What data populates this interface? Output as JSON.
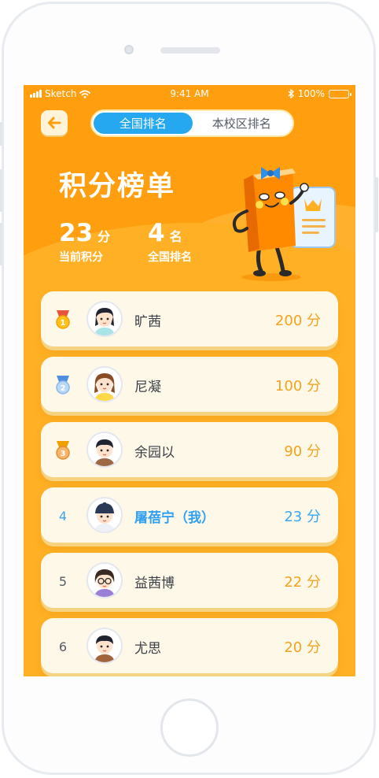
{
  "status_bar": {
    "carrier": "Sketch",
    "time": "9:41 AM",
    "battery": "100%"
  },
  "tabs": [
    {
      "label": "全国排名",
      "active": true
    },
    {
      "label": "本校区排名",
      "active": false
    }
  ],
  "page_title": "积分榜单",
  "stats": {
    "points": {
      "value": "23",
      "unit": "分",
      "label": "当前积分"
    },
    "rank": {
      "value": "4",
      "unit": "名",
      "label": "全国排名"
    }
  },
  "ranking": [
    {
      "rank": "1",
      "medal": "gold",
      "name": "旷茜",
      "score": "200 分",
      "me": false
    },
    {
      "rank": "2",
      "medal": "silver",
      "name": "尼凝",
      "score": "100 分",
      "me": false
    },
    {
      "rank": "3",
      "medal": "bronze",
      "name": "余园以",
      "score": "90 分",
      "me": false
    },
    {
      "rank": "4",
      "medal": null,
      "name": "屠蓓宁（我）",
      "score": "23 分",
      "me": true
    },
    {
      "rank": "5",
      "medal": null,
      "name": "益茜博",
      "score": "22 分",
      "me": false
    },
    {
      "rank": "6",
      "medal": null,
      "name": "尤思",
      "score": "20 分",
      "me": false
    }
  ],
  "colors": {
    "header_orange": "#ff9f10",
    "body_orange": "#ffb024",
    "active_tab_blue": "#25a8f0",
    "score_orange": "#f5a21c",
    "highlight_blue": "#2fa0f2",
    "card_bg": "#fdf8e8"
  },
  "icons": {
    "back": "arrow-left-icon",
    "wifi": "wifi-icon",
    "bluetooth": "bluetooth-icon",
    "battery": "battery-icon",
    "medal_1": "gold-medal-icon",
    "medal_2": "silver-medal-icon",
    "medal_3": "bronze-medal-icon"
  }
}
